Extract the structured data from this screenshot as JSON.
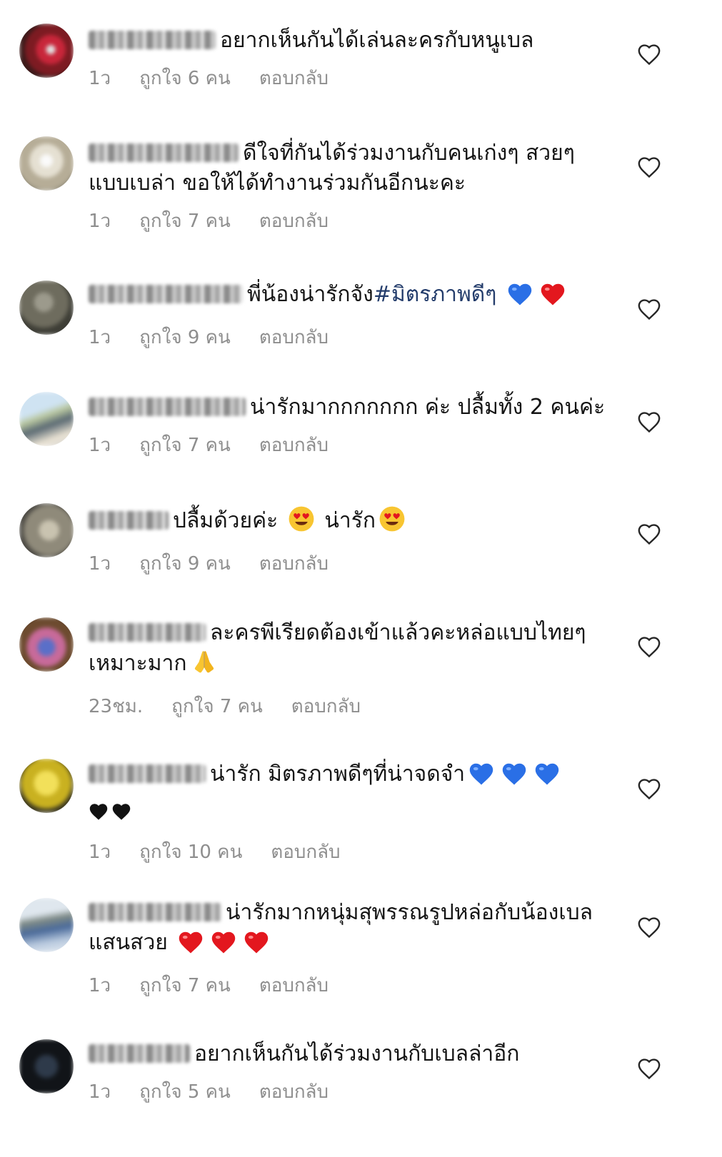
{
  "colors": {
    "meta_text": "#8e8e8e",
    "hashtag": "#233c6b",
    "blue_heart": "#2a6fe6",
    "red_heart": "#e3171e"
  },
  "comments": [
    {
      "username_blurred": "beyt_orinl",
      "text_lines": [
        "อยากเห็นกันได้เล่นละครกับหนูเบล"
      ],
      "time": "1ว",
      "likes": "ถูกใจ 6 คน",
      "reply": "ตอบกลับ",
      "like_icon": "heart-outline-icon"
    },
    {
      "username_blurred": "pichaponsilan",
      "text_lines": [
        "ดีใจที่กันได้ร่วมงานกับคนเก่งๆ สวยๆ",
        "แบบเบล่า ขอให้ได้ทำงานร่วมกันอีกนะคะ"
      ],
      "time": "1ว",
      "likes": "ถูกใจ 7 คน",
      "reply": "ตอบกลับ",
      "like_icon": "heart-outline-icon"
    },
    {
      "username_blurred": "user1372606",
      "text_lines": [
        "พี่น้องน่ารักจัง"
      ],
      "hashtag": "#มิตรภาพดีๆ",
      "emojis": [
        "blue-heart-emoji",
        "red-heart-emoji"
      ],
      "time": "1ว",
      "likes": "ถูกใจ 9 คน",
      "reply": "ตอบกลับ",
      "like_icon": "heart-outline-icon"
    },
    {
      "username_blurred": "pasem_nalinee",
      "text_lines": [
        "น่ารักมากกกกกกก ค่ะ  ปลื้มทั้ง 2 คนค่ะ"
      ],
      "time": "1ว",
      "likes": "ถูกใจ 7 คน",
      "reply": "ตอบกลับ",
      "like_icon": "heart-outline-icon"
    },
    {
      "username_blurred": "peeaop",
      "text_parts": [
        "ปลื้มด้วยค่ะ",
        "น่ารัก"
      ],
      "emojis": [
        "heart-eyes-emoji",
        "heart-eyes-emoji"
      ],
      "time": "1ว",
      "likes": "ถูกใจ 9 คน",
      "reply": "ตอบกลับ",
      "like_icon": "heart-outline-icon"
    },
    {
      "username_blurred": "plangen04",
      "text_lines": [
        "ละครพีเรียดต้องเข้าแล้วคะหล่อแบบไทยๆ",
        "เหมาะมาก"
      ],
      "emojis": [
        "folded-hands-emoji"
      ],
      "time": "23ชม.",
      "likes": "ถูกใจ 7 คน",
      "reply": "ตอบกลับ",
      "like_icon": "heart-outline-icon"
    },
    {
      "username_blurred": "pulplimping",
      "text_lines": [
        "น่ารัก มิตรภาพดีๆที่น่าจดจำ"
      ],
      "emojis": [
        "blue-heart-emoji",
        "blue-heart-emoji",
        "blue-heart-emoji",
        "black-heart-emoji",
        "black-heart-emoji"
      ],
      "time": "1ว",
      "likes": "ถูกใจ 10 คน",
      "reply": "ตอบกลับ",
      "like_icon": "heart-outline-icon"
    },
    {
      "username_blurred": "adsongkhan",
      "text_lines": [
        "น่ารักมากหนุ่มสุพรรณรูปหล่อกับน้องเบล",
        "แสนสวย"
      ],
      "emojis": [
        "red-heart-emoji",
        "red-heart-emoji",
        "red-heart-emoji"
      ],
      "time": "1ว",
      "likes": "ถูกใจ 7 คน",
      "reply": "ตอบกลับ",
      "like_icon": "heart-outline-icon"
    },
    {
      "username_blurred": "planoy_t",
      "text_lines": [
        "อยากเห็นกันได้ร่วมงานกับเบลล่าอีก"
      ],
      "time": "1ว",
      "likes": "ถูกใจ 5 คน",
      "reply": "ตอบกลับ",
      "like_icon": "heart-outline-icon"
    }
  ]
}
